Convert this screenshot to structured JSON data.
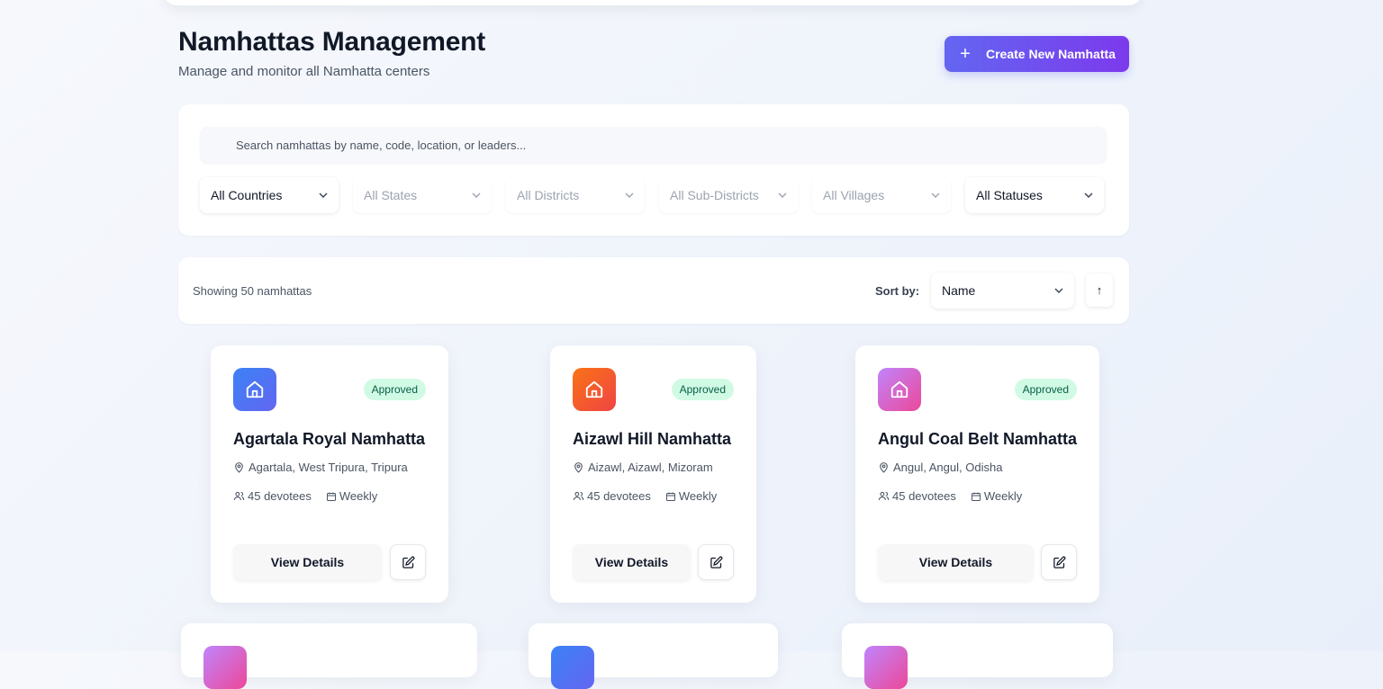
{
  "header": {
    "title": "Namhattas Management",
    "subtitle": "Manage and monitor all Namhatta centers",
    "create_button": "Create New Namhatta"
  },
  "search": {
    "placeholder": "Search namhattas by name, code, location, or leaders..."
  },
  "filters": [
    {
      "label": "All Countries",
      "enabled": true
    },
    {
      "label": "All States",
      "enabled": false
    },
    {
      "label": "All Districts",
      "enabled": false
    },
    {
      "label": "All Sub-Districts",
      "enabled": false
    },
    {
      "label": "All Villages",
      "enabled": false
    },
    {
      "label": "All Statuses",
      "enabled": true
    }
  ],
  "results": {
    "showing_text": "Showing 50 namhattas",
    "sort_label": "Sort by:",
    "sort_value": "Name",
    "sort_direction": "↑"
  },
  "cards": [
    {
      "name": "Agartala Royal Namhatta",
      "status": "Approved",
      "location": "Agartala, West Tripura, Tripura",
      "devotees": "45 devotees",
      "frequency": "Weekly",
      "view_label": "View Details",
      "icon_gradient": [
        "#3b82f6",
        "#6366f1"
      ]
    },
    {
      "name": "Aizawl Hill Namhatta",
      "status": "Approved",
      "location": "Aizawl, Aizawl, Mizoram",
      "devotees": "45 devotees",
      "frequency": "Weekly",
      "view_label": "View Details",
      "icon_gradient": [
        "#f97316",
        "#ef4444"
      ]
    },
    {
      "name": "Angul Coal Belt Namhatta",
      "status": "Approved",
      "location": "Angul, Angul, Odisha",
      "devotees": "45 devotees",
      "frequency": "Weekly",
      "view_label": "View Details",
      "icon_gradient": [
        "#c084fc",
        "#ec4899"
      ]
    }
  ],
  "colors": {
    "accent": "#6366f1",
    "accent_end": "#7c3aed",
    "approved_bg": "#d1fae5",
    "approved_text": "#065f46"
  }
}
